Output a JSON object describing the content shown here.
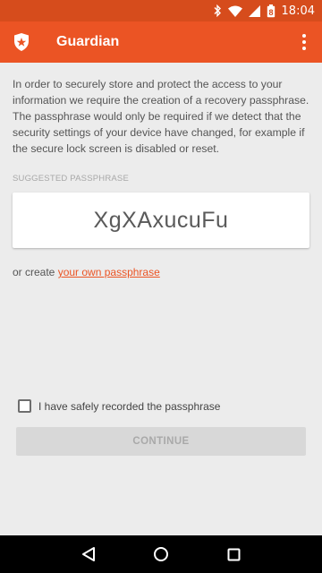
{
  "status_bar": {
    "time": "18:04",
    "battery_level": "8",
    "icons": [
      "bluetooth-icon",
      "wifi-icon",
      "signal-icon",
      "battery-icon"
    ]
  },
  "app_bar": {
    "title": "Guardian",
    "logo_icon": "auth0-shield-icon",
    "menu_icon": "overflow-menu-icon"
  },
  "intro": {
    "paragraph_1": "In order to securely store and protect the access to your information we require the creation of a recovery passphrase.",
    "paragraph_2": "The passphrase would only be required if we detect that the security settings of your device have changed, for example if the secure lock screen is disabled or reset."
  },
  "passphrase": {
    "label": "SUGGESTED PASSPHRASE",
    "value": "XgXAxucuFu"
  },
  "create_own": {
    "prefix": "or create ",
    "link_text": "your own passphrase"
  },
  "confirm": {
    "label": "I have safely recorded the passphrase",
    "checked": false
  },
  "continue_button": {
    "label": "CONTINUE",
    "enabled": false
  },
  "colors": {
    "accent": "#eb5424",
    "status_bar": "#d64c1c",
    "background": "#ececec"
  }
}
